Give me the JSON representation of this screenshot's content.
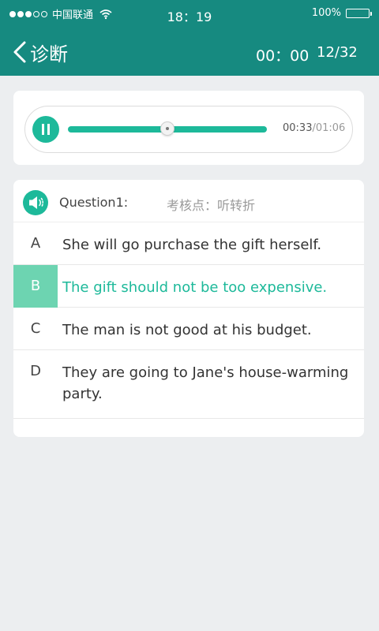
{
  "status_bar": {
    "carrier": "中国联通",
    "time": "18：19",
    "battery": "100%"
  },
  "nav": {
    "title": "诊断",
    "timer": "00：00",
    "progress": "12/32"
  },
  "player": {
    "current_time": "00:33",
    "separator": "/",
    "total_time": "01:06",
    "played_fraction": 0.5
  },
  "question": {
    "label": "Question1:",
    "point": "考核点：听转折",
    "options": [
      {
        "letter": "A",
        "text": "She will go purchase the gift herself."
      },
      {
        "letter": "B",
        "text": "The gift should not be too expensive."
      },
      {
        "letter": "C",
        "text": "The man is not good at his budget."
      },
      {
        "letter": "D",
        "text": "They are going to Jane's house-warming party."
      }
    ],
    "selected": "B"
  },
  "colors": {
    "header": "#168a80",
    "accent": "#1db99a",
    "selected_fill": "#6dd4b1"
  }
}
